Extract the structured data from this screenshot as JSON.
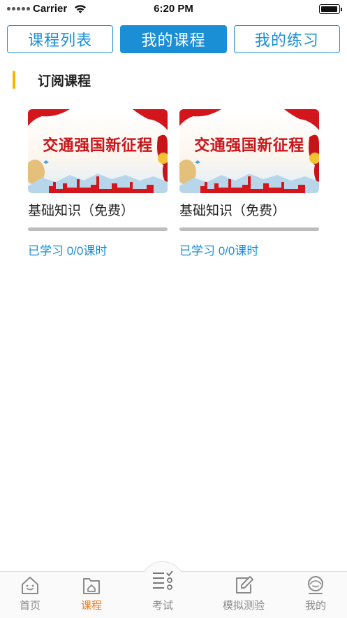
{
  "status_bar": {
    "carrier": "Carrier",
    "time": "6:20 PM"
  },
  "tabs": [
    {
      "label": "课程列表",
      "active": false
    },
    {
      "label": "我的课程",
      "active": true
    },
    {
      "label": "我的练习",
      "active": false
    }
  ],
  "section": {
    "title": "订阅课程"
  },
  "courses": [
    {
      "banner_text": "交通强国新征程",
      "name": "基础知识（免费）",
      "progress_fraction": 0,
      "progress_text": "已学习 0/0课时"
    },
    {
      "banner_text": "交通强国新征程",
      "name": "基础知识（免费）",
      "progress_fraction": 0,
      "progress_text": "已学习 0/0课时"
    }
  ],
  "bottom_nav": [
    {
      "label": "首页",
      "icon": "home-icon",
      "active": false
    },
    {
      "label": "课程",
      "icon": "course-icon",
      "active": true
    },
    {
      "label": "考试",
      "icon": "exam-checklist-icon",
      "active": false
    },
    {
      "label": "模拟测验",
      "icon": "edit-icon",
      "active": false
    },
    {
      "label": "我的",
      "icon": "profile-icon",
      "active": false
    }
  ],
  "colors": {
    "accent": "#1a8fd6",
    "active_nav": "#f07c1e",
    "section_bar": "#f7b500",
    "banner_red": "#c8171c"
  }
}
